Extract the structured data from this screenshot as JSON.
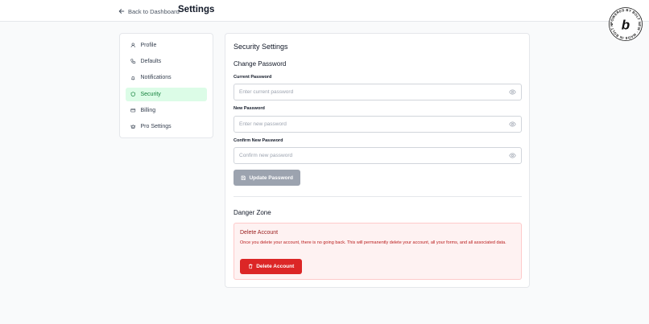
{
  "header": {
    "back_label": "Back to Dashboard",
    "title": "Settings",
    "badge_text": "POWERED BY BOLT NEW · MADE IN BOLT NEW ·",
    "badge_letter": "b"
  },
  "sidebar": {
    "items": [
      {
        "label": "Profile",
        "icon": "user-icon"
      },
      {
        "label": "Defaults",
        "icon": "phone-icon"
      },
      {
        "label": "Notifications",
        "icon": "bell-icon"
      },
      {
        "label": "Security",
        "icon": "shield-icon",
        "active": true
      },
      {
        "label": "Billing",
        "icon": "credit-card-icon"
      },
      {
        "label": "Pro Settings",
        "icon": "crown-icon"
      }
    ]
  },
  "security": {
    "title": "Security Settings",
    "change_password": {
      "title": "Change Password",
      "current_label": "Current Password",
      "current_placeholder": "Enter current password",
      "new_label": "New Password",
      "new_placeholder": "Enter new password",
      "confirm_label": "Confirm New Password",
      "confirm_placeholder": "Confirm new password",
      "update_button": "Update Password"
    },
    "danger_zone": {
      "title": "Danger Zone",
      "delete_title": "Delete Account",
      "delete_text": "Once you delete your account, there is no going back. This will permanently delete your account, all your forms, and all associated data.",
      "delete_button": "Delete Account"
    }
  },
  "colors": {
    "active_bg": "#dcfce7",
    "active_text": "#15803d",
    "danger_bg": "#fef2f2",
    "danger_text": "#991b1b",
    "danger_button": "#dc2626",
    "disabled_button": "#9ca3af"
  }
}
